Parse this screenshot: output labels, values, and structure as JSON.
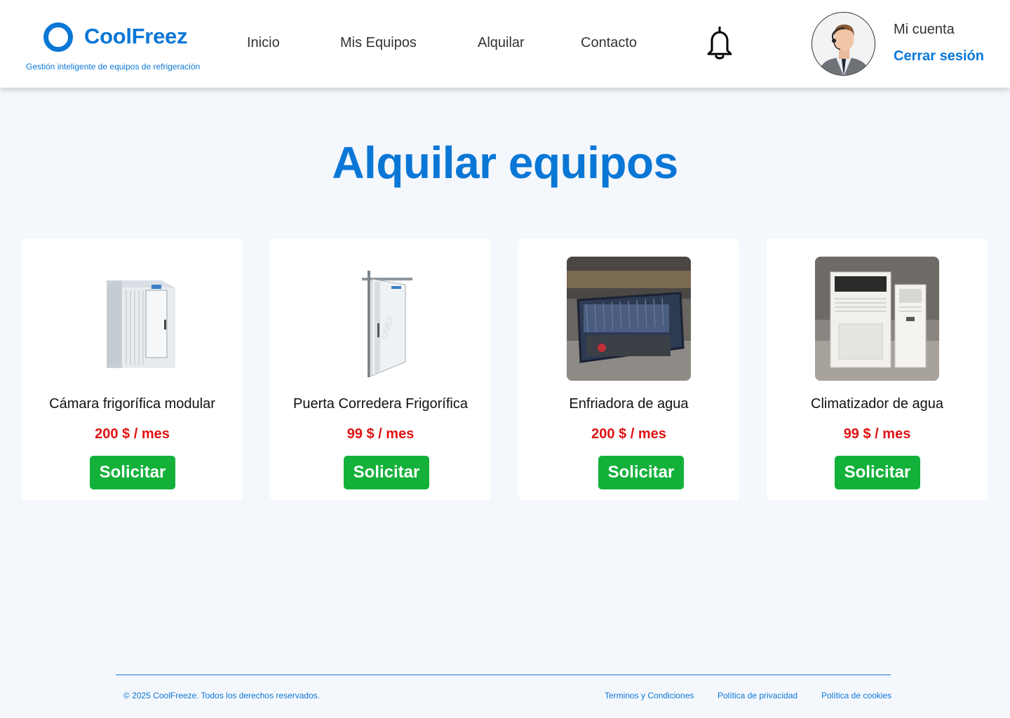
{
  "brand": {
    "name": "CoolFreez",
    "tagline": "Gestión inteligente de equipos de refrigeración",
    "color": "#0a77d6"
  },
  "nav": {
    "items": [
      {
        "label": "Inicio"
      },
      {
        "label": "Mis Equipos"
      },
      {
        "label": "Alquilar"
      },
      {
        "label": "Contacto"
      }
    ],
    "notification_icon": "bell-icon"
  },
  "account": {
    "label": "Mi cuenta",
    "logout": "Cerrar sesión",
    "avatar_icon": "user-avatar"
  },
  "page": {
    "title": "Alquilar equipos"
  },
  "products": [
    {
      "name": "Cámara frigorífica modular",
      "price": "200 $ / mes",
      "button": "Solicitar",
      "image": "cold-room-image"
    },
    {
      "name": "Puerta Corredera Frigorífica",
      "price": "99 $ / mes",
      "button": "Solicitar",
      "image": "sliding-door-image"
    },
    {
      "name": "Enfriadora de agua",
      "price": "200 $ / mes",
      "button": "Solicitar",
      "image": "water-chiller-image"
    },
    {
      "name": "Climatizador de agua",
      "price": "99 $ / mes",
      "button": "Solicitar",
      "image": "water-cooler-image"
    }
  ],
  "footer": {
    "copyright": "© 2025 CoolFreeze. Todos los derechos reservados.",
    "links": [
      {
        "label": "Terminos y Condiciones"
      },
      {
        "label": "Política de privacidad"
      },
      {
        "label": "Política de cookies"
      }
    ]
  },
  "colors": {
    "accent": "#0a77d6",
    "price": "#e01313",
    "button": "#13b13a",
    "background": "#f4f7fc"
  }
}
